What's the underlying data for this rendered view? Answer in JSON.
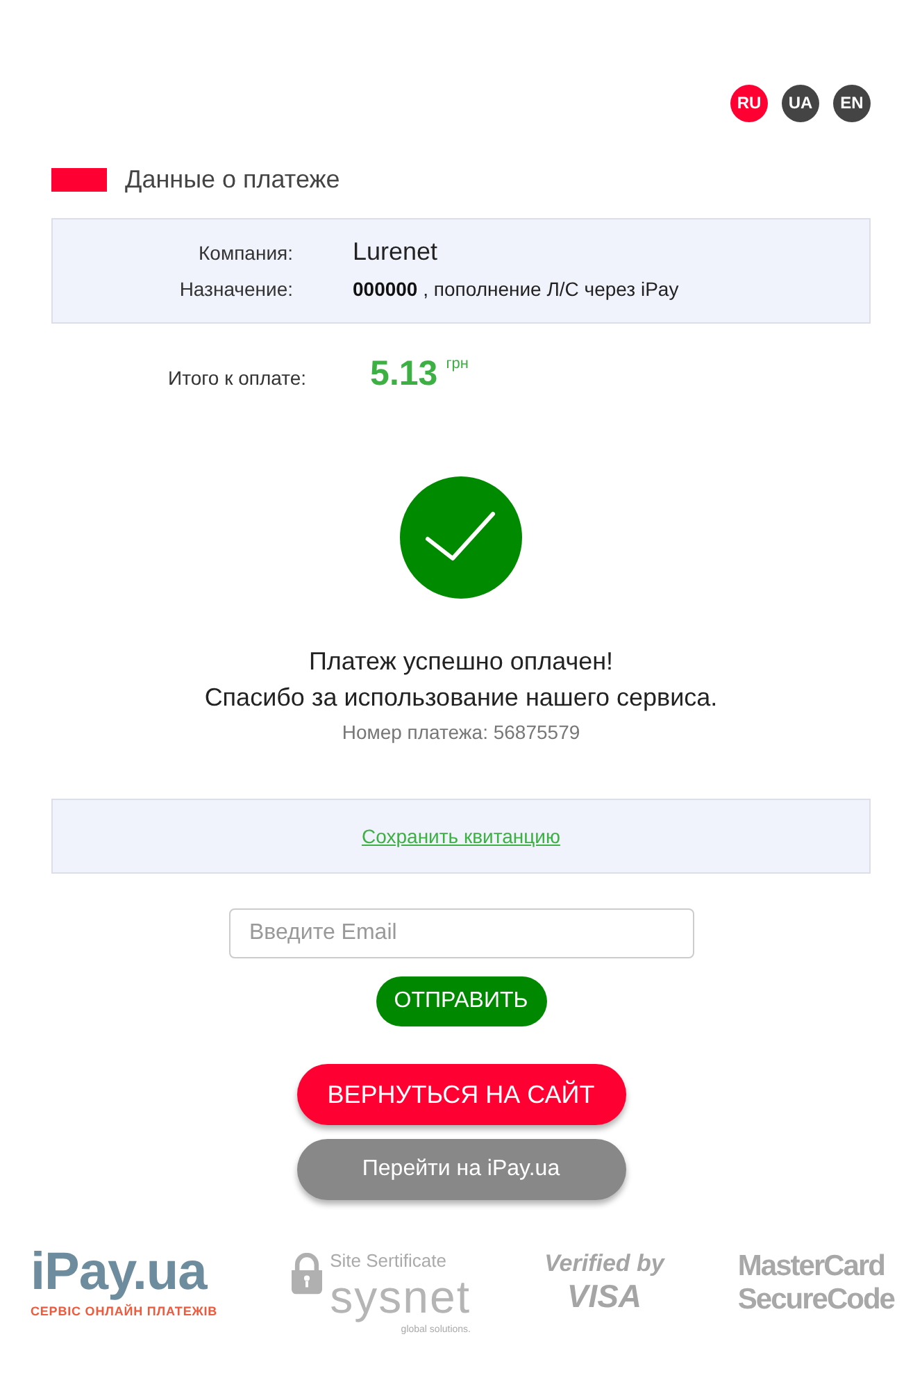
{
  "languages": [
    {
      "label": "RU",
      "selected": true
    },
    {
      "label": "UA",
      "selected": false
    },
    {
      "label": "EN",
      "selected": false
    }
  ],
  "section": {
    "title": "Данные о платеже"
  },
  "details": [
    {
      "label": "Компания:",
      "value": "Lurenet",
      "kind": "large"
    },
    {
      "label": "Назначение:",
      "value": "**000000** , пополнение Л/С через iPay",
      "kind": "normal"
    }
  ],
  "total": {
    "label": "Итого к оплате:",
    "amount": "5.13",
    "currency": "грн"
  },
  "result": {
    "title": "Платеж успешно оплачен!",
    "message": "Спасибо за использование нашего сервиса.",
    "payment_number": "Номер платежа: 56875579"
  },
  "receipt_link": "Сохранить квитанцию",
  "email": {
    "placeholder": "Введите Email"
  },
  "send_button": "ОТПРАВИТЬ",
  "return_button": "ВЕРНУТЬСЯ НА САЙТ",
  "ipay_button": "Перейти на iPay.ua",
  "footer_logos": [
    {
      "kind": "ipay",
      "text": "iPay.ua",
      "subtext": "СЕРВІС ОНЛАЙН ПЛАТЕЖІВ"
    },
    {
      "kind": "sysnet",
      "caption": "Site Sertificate",
      "text": "sysnet",
      "subtext": "global solutions."
    },
    {
      "kind": "visa",
      "text": "Verified by",
      "subtext": "VISA"
    },
    {
      "kind": "mastercard",
      "text": "MasterCard",
      "subtext": "SecureCode"
    }
  ]
}
